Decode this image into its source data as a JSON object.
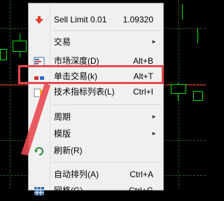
{
  "menu": {
    "items": [
      {
        "label": "Sell Limit 0.01",
        "shortcut": "1.09320",
        "icon": "sell-limit-arrow-icon"
      },
      {
        "label": "交易",
        "shortcut": "",
        "icon": "",
        "submenu": true
      },
      {
        "label": "市场深度(D)",
        "shortcut": "Alt+B",
        "icon": "market-depth-icon"
      },
      {
        "label": "单击交易(k)",
        "shortcut": "Alt+T",
        "icon": "one-click-trading-icon"
      },
      {
        "label": "技术指标列表(L)",
        "shortcut": "Ctrl+I",
        "icon": "indicator-list-icon"
      },
      {
        "label": "周期",
        "shortcut": "",
        "icon": "",
        "submenu": true
      },
      {
        "label": "模版",
        "shortcut": "",
        "icon": "",
        "submenu": true
      },
      {
        "label": "刷新(R)",
        "shortcut": "",
        "icon": "refresh-icon"
      },
      {
        "label": "自动排列(A)",
        "shortcut": "Ctrl+A",
        "icon": ""
      },
      {
        "label": "网格(G)",
        "shortcut": "Ctrl+G",
        "icon": "grid-icon"
      }
    ],
    "submenu_arrow": "►"
  },
  "colors": {
    "highlight": "#e8484f",
    "candle": "#00e000",
    "chart_bg": "#000000",
    "menu_bg": "#f0f0f0"
  }
}
